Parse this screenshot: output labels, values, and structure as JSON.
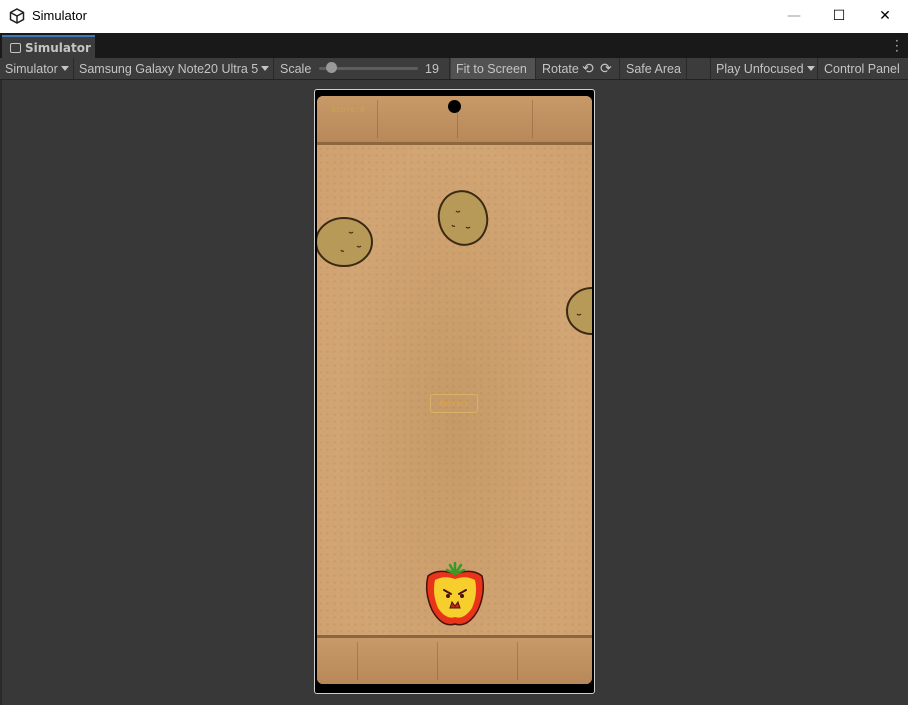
{
  "window": {
    "title": "Simulator",
    "minimize": "—",
    "maximize": "☐",
    "close": "✕"
  },
  "tab": {
    "label": "Simulator"
  },
  "toolbar": {
    "mode": "Simulator",
    "device": "Samsung Galaxy Note20 Ultra 5",
    "scale_label": "Scale",
    "scale_value": "19",
    "fit_label": "Fit to Screen",
    "rotate_label": "Rotate",
    "safe_area_label": "Safe Area",
    "play_mode": "Play Unfocused",
    "control_panel_label": "Control Panel"
  },
  "game": {
    "score_text": "Score:0",
    "restart_label": "Restart"
  },
  "colors": {
    "accent_tab": "#3a79bb",
    "editor_bg": "#383838",
    "wood": "#d2a574"
  }
}
